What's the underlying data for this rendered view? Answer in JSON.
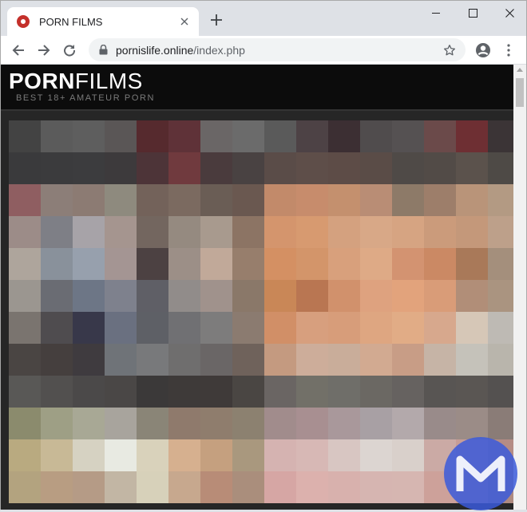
{
  "browser": {
    "tab_title": "PORN FILMS",
    "url_domain": "pornislife.online",
    "url_path": "/index.php"
  },
  "site": {
    "logo_bold": "PORN",
    "logo_light": "FILMS",
    "tagline": "BEST 18+ AMATEUR PORN"
  },
  "icons": {
    "favicon": "video-favicon-icon",
    "back": "back-arrow-icon",
    "forward": "forward-arrow-icon",
    "reload": "reload-icon",
    "lock": "lock-icon",
    "bookmark": "star-icon",
    "profile": "account-icon",
    "menu": "kebab-menu-icon",
    "overlay": "malwarebytes-logo-icon"
  },
  "colors": {
    "brand_red": "#c4302b",
    "watermark_blue": "#3b5bdb"
  }
}
